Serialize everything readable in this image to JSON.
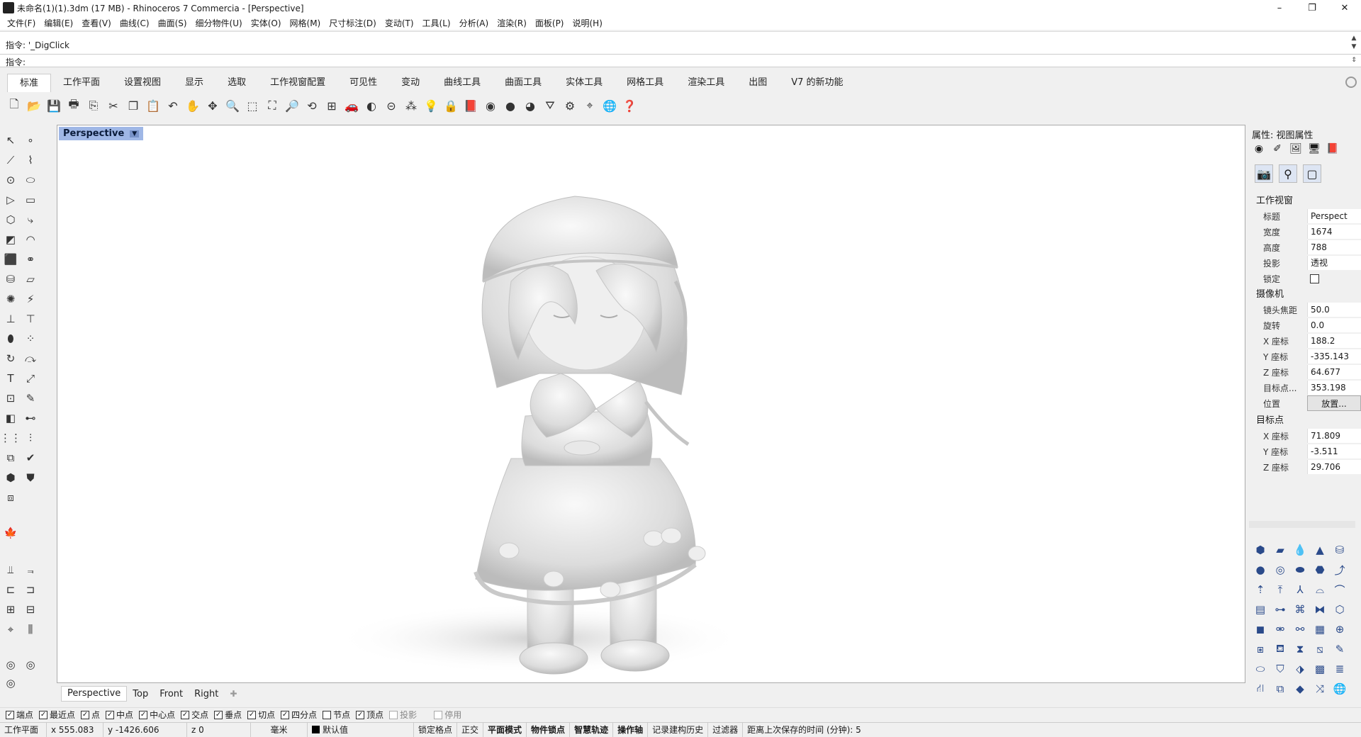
{
  "window": {
    "title": "未命名(1)(1).3dm (17 MB) - Rhinoceros 7 Commercia - [Perspective]",
    "controls": [
      "–",
      "❐",
      "✕"
    ]
  },
  "menu": [
    "文件(F)",
    "编辑(E)",
    "查看(V)",
    "曲线(C)",
    "曲面(S)",
    "细分物件(U)",
    "实体(O)",
    "网格(M)",
    "尺寸标注(D)",
    "变动(T)",
    "工具(L)",
    "分析(A)",
    "渲染(R)",
    "面板(P)",
    "说明(H)"
  ],
  "command": {
    "history": "指令: '_DigClick",
    "prompt": "指令:",
    "value": ""
  },
  "tabs": [
    "标准",
    "工作平面",
    "设置视图",
    "显示",
    "选取",
    "工作视窗配置",
    "可见性",
    "变动",
    "曲线工具",
    "曲面工具",
    "实体工具",
    "网格工具",
    "渲染工具",
    "出图",
    "V7 的新功能"
  ],
  "active_tab": "标准",
  "viewport": {
    "label": "Perspective"
  },
  "viewport_tabs": [
    "Perspective",
    "Top",
    "Front",
    "Right",
    "✚"
  ],
  "properties": {
    "header": "属性: 视图属性",
    "section_viewport": "工作视窗",
    "title_label": "标题",
    "title_value": "Perspect",
    "width_label": "宽度",
    "width_value": "1674",
    "height_label": "高度",
    "height_value": "788",
    "projection_label": "投影",
    "projection_value": "透视",
    "lock_label": "锁定",
    "section_camera": "摄像机",
    "lens_label": "镜头焦距",
    "lens_value": "50.0",
    "rotation_label": "旋转",
    "rotation_value": "0.0",
    "cam_x_label": "X 座标",
    "cam_x_value": "188.2",
    "cam_y_label": "Y 座标",
    "cam_y_value": "-335.143",
    "cam_z_label": "Z 座标",
    "cam_z_value": "64.677",
    "target_dist_label": "目标点...",
    "target_dist_value": "353.198",
    "position_label": "位置",
    "position_button": "放置...",
    "section_target": "目标点",
    "tgt_x_label": "X 座标",
    "tgt_x_value": "71.809",
    "tgt_y_label": "Y 座标",
    "tgt_y_value": "-3.511",
    "tgt_z_label": "Z 座标",
    "tgt_z_value": "29.706"
  },
  "osnaps": [
    {
      "label": "端点",
      "checked": true
    },
    {
      "label": "最近点",
      "checked": true
    },
    {
      "label": "点",
      "checked": true
    },
    {
      "label": "中点",
      "checked": true
    },
    {
      "label": "中心点",
      "checked": true
    },
    {
      "label": "交点",
      "checked": true
    },
    {
      "label": "垂点",
      "checked": true
    },
    {
      "label": "切点",
      "checked": true
    },
    {
      "label": "四分点",
      "checked": true
    },
    {
      "label": "节点",
      "checked": false
    },
    {
      "label": "顶点",
      "checked": true
    },
    {
      "label": "投影",
      "checked": false
    },
    {
      "label": "停用",
      "checked": false
    }
  ],
  "status": {
    "cplane": "工作平面",
    "x": "x 555.083",
    "y": "y -1426.606",
    "z": "z 0",
    "units": "毫米",
    "layer": "默认值",
    "grid_snap": "锁定格点",
    "ortho": "正交",
    "planar": "平面模式",
    "osnap": "物件锁点",
    "smarttrack": "智慧轨迹",
    "gumball": "操作轴",
    "history": "记录建构历史",
    "filter": "过滤器",
    "autosave": "距离上次保存的时间 (分钟): 5"
  }
}
